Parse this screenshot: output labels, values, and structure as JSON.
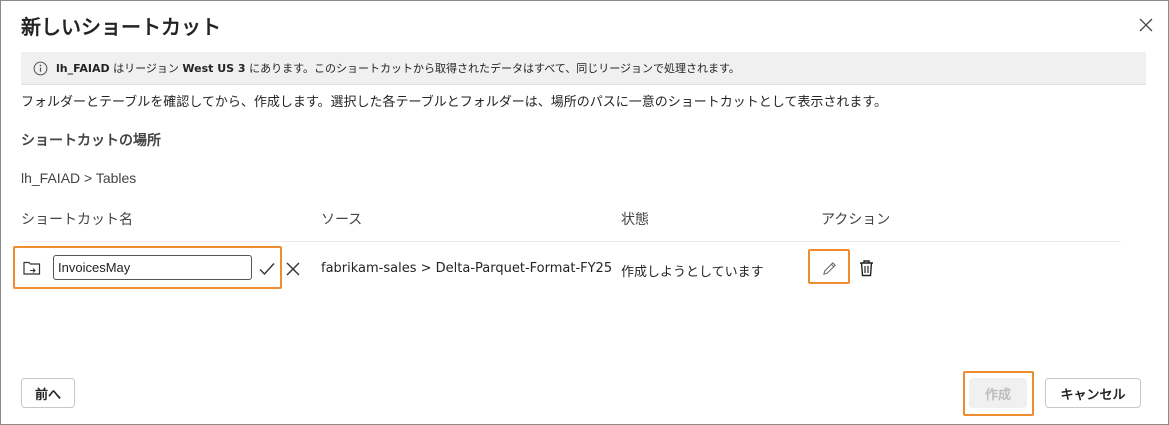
{
  "dialog": {
    "title": "新しいショートカット",
    "close_icon": "close-icon"
  },
  "banner": {
    "icon": "info-icon",
    "name": "lh_FAIAD",
    "text_mid": " はリージョン ",
    "region": "West US 3",
    "text_end": " にあります。このショートカットから取得されたデータはすべて、同じリージョンで処理されます。"
  },
  "description": "フォルダーとテーブルを確認してから、作成します。選択した各テーブルとフォルダーは、場所のパスに一意のショートカットとして表示されます。",
  "location": {
    "heading": "ショートカットの場所",
    "path": "lh_FAIAD > Tables"
  },
  "table": {
    "headers": {
      "name": "ショートカット名",
      "source": "ソース",
      "status": "状態",
      "action": "アクション"
    },
    "rows": [
      {
        "icon": "shortcut-folder-icon",
        "name_value": "InvoicesMay",
        "source": "fabrikam-sales > Delta-Parquet-Format-FY25 ...",
        "status": "作成しようとしています",
        "actions": [
          "edit-icon",
          "delete-icon"
        ]
      }
    ]
  },
  "footer": {
    "back_label": "前へ",
    "create_label": "作成",
    "cancel_label": "キャンセル"
  },
  "colors": {
    "highlight": "#f08c30",
    "banner_bg": "#f0f0f0"
  }
}
